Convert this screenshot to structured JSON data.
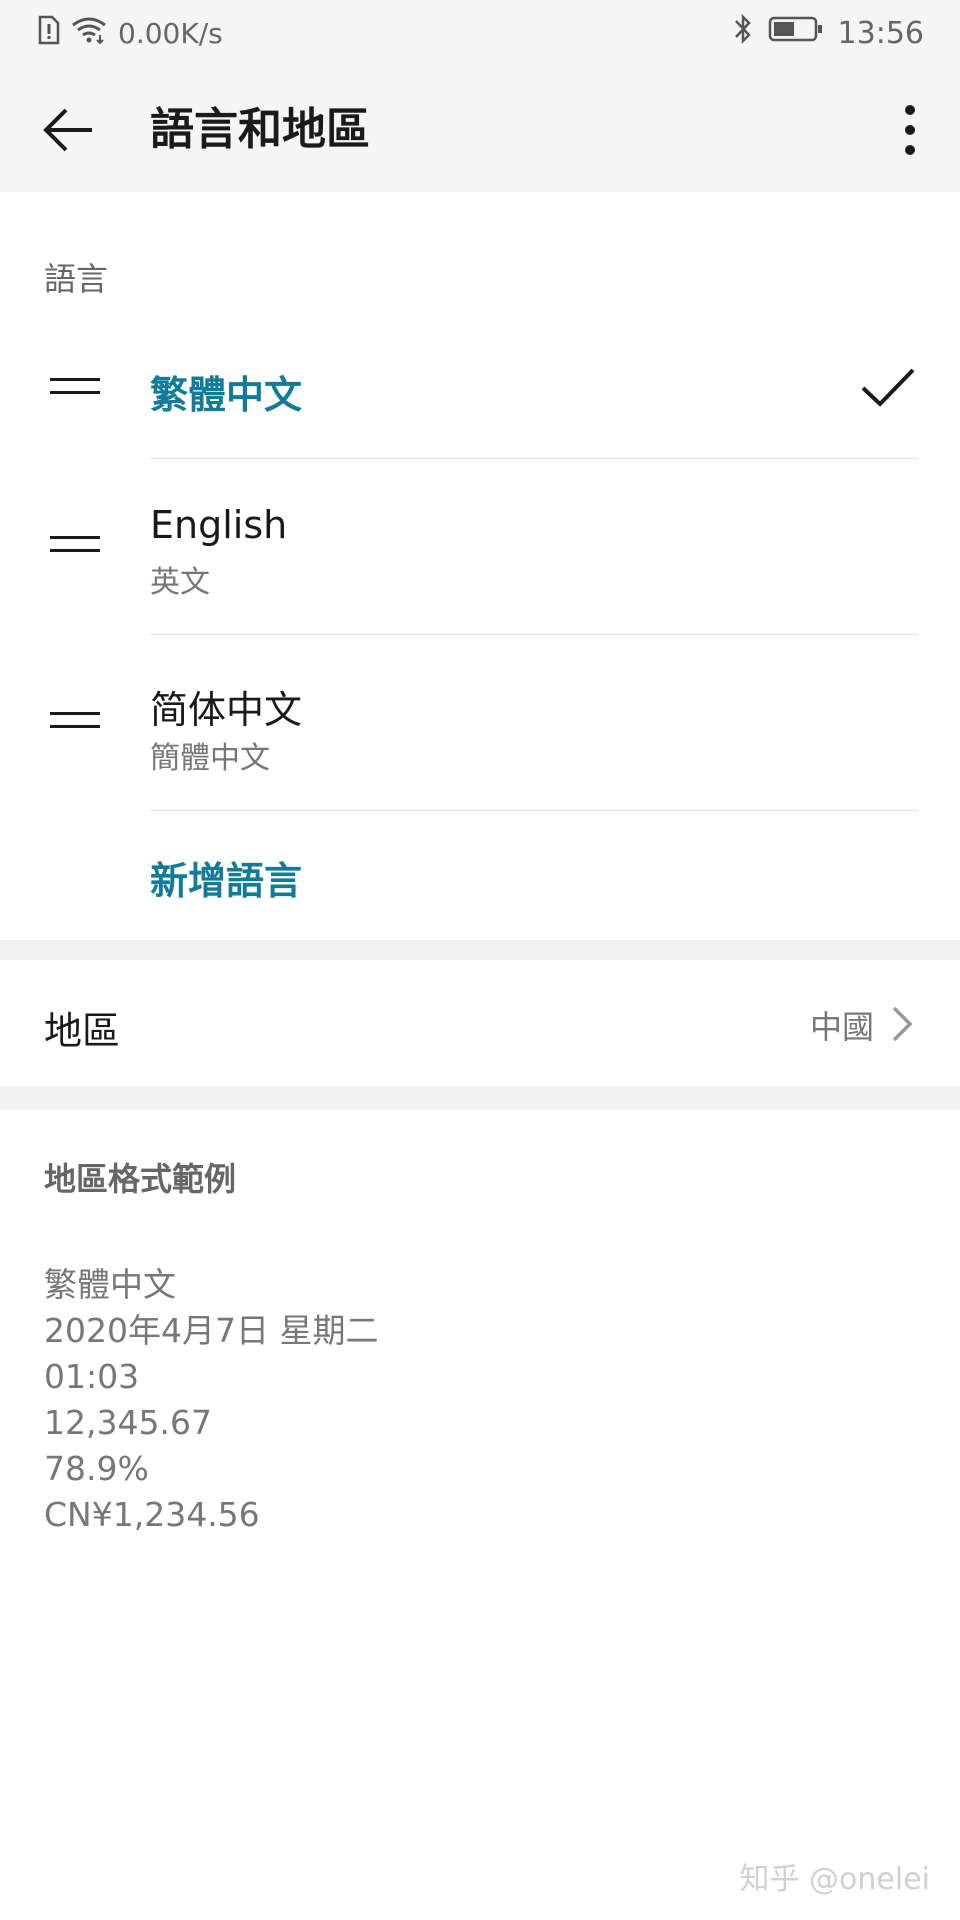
{
  "status_bar": {
    "network_speed": "0.00K/s",
    "time": "13:56",
    "icons": [
      "sim-alert-icon",
      "wifi-icon",
      "bluetooth-icon",
      "battery-icon"
    ]
  },
  "app_bar": {
    "title": "語言和地區"
  },
  "languages_section": {
    "label": "語言",
    "items": [
      {
        "primary": "繁體中文",
        "secondary": "",
        "selected": true
      },
      {
        "primary": "English",
        "secondary": "英文",
        "selected": false
      },
      {
        "primary": "简体中文",
        "secondary": "簡體中文",
        "selected": false
      }
    ],
    "add_language": "新增語言"
  },
  "region": {
    "label": "地區",
    "value": "中國"
  },
  "format_examples": {
    "label": "地區格式範例",
    "lines": [
      "繁體中文",
      "2020年4月7日 星期二",
      "01:03",
      "12,345.67",
      "78.9%",
      "CN¥1,234.56"
    ]
  },
  "watermark": "知乎 @onelei",
  "colors": {
    "accent": "#137b9a",
    "background": "#ffffff",
    "section_gap": "#f2f2f2",
    "app_bar": "#f5f5f5"
  }
}
